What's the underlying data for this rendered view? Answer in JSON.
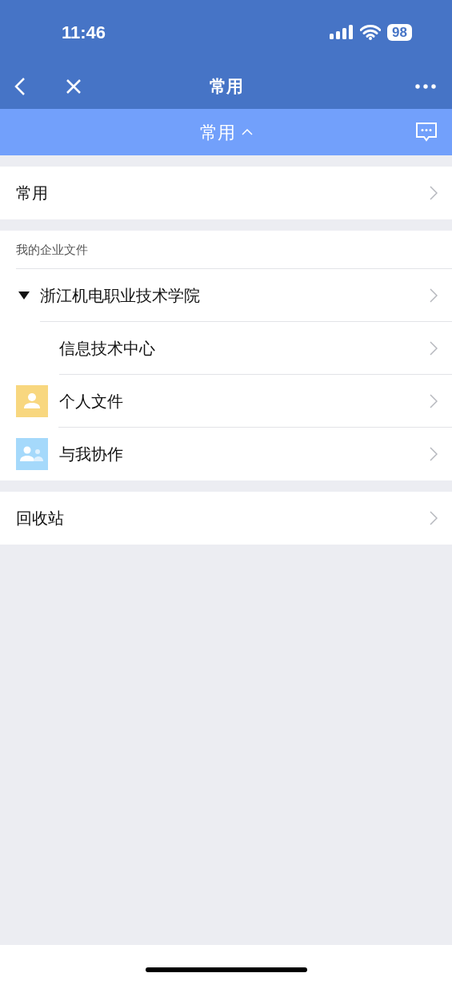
{
  "status_bar": {
    "time": "11:46",
    "battery": "98"
  },
  "nav_bar": {
    "title": "常用"
  },
  "sub_bar": {
    "title": "常用",
    "expanded": true
  },
  "sections": [
    {
      "items": [
        {
          "kind": "plain",
          "label": "常用"
        }
      ]
    },
    {
      "header": "我的企业文件",
      "items": [
        {
          "kind": "folder",
          "label": "浙江机电职业技术学院",
          "expanded": true,
          "children": [
            {
              "label": "信息技术中心"
            }
          ]
        },
        {
          "kind": "personal",
          "label": "个人文件"
        },
        {
          "kind": "shared",
          "label": "与我协作"
        }
      ]
    },
    {
      "items": [
        {
          "kind": "plain",
          "label": "回收站"
        }
      ]
    }
  ]
}
